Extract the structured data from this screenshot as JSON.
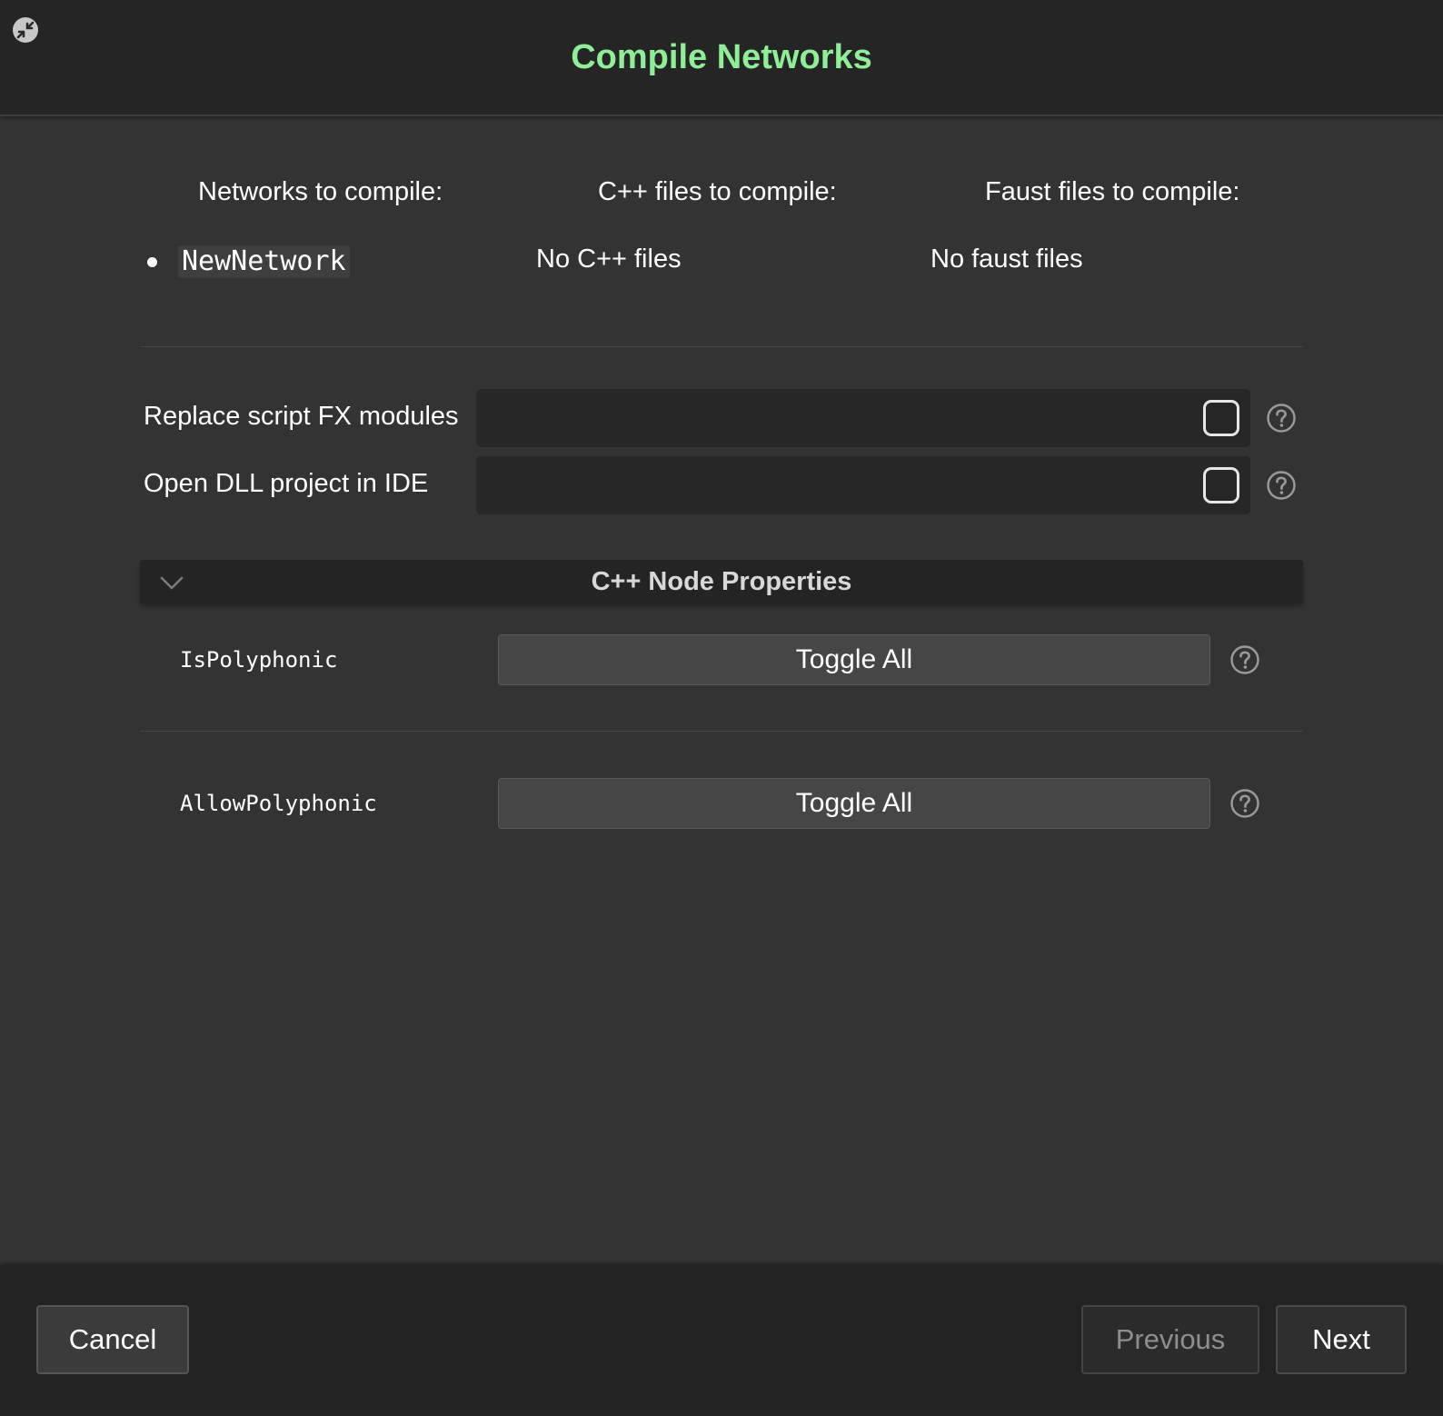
{
  "header": {
    "title": "Compile Networks",
    "title_color": "#90ee98"
  },
  "columns": {
    "networks": {
      "heading": "Networks to compile:",
      "items": [
        "NewNetwork"
      ]
    },
    "cpp": {
      "heading": "C++ files to compile:",
      "empty_text": "No C++ files"
    },
    "faust": {
      "heading": "Faust files to compile:",
      "empty_text": "No faust files"
    }
  },
  "options": [
    {
      "label": "Replace script FX modules",
      "checked": false
    },
    {
      "label": "Open DLL project in IDE",
      "checked": false
    }
  ],
  "node_properties": {
    "title": "C++ Node Properties",
    "expanded": true,
    "rows": [
      {
        "name": "IsPolyphonic",
        "button": "Toggle All"
      },
      {
        "name": "AllowPolyphonic",
        "button": "Toggle All"
      }
    ]
  },
  "footer": {
    "cancel": "Cancel",
    "previous": "Previous",
    "next": "Next"
  },
  "icons": {
    "corner": "collapse-arrows-icon",
    "help": "question-mark-circle-icon",
    "chevron": "chevron-down-icon"
  }
}
